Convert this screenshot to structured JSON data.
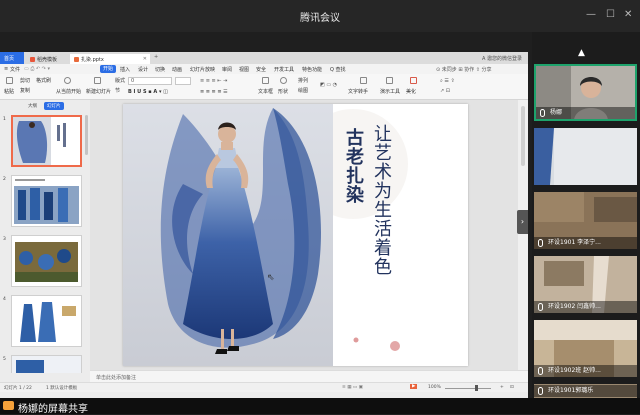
{
  "app": {
    "title": "腾讯会议"
  },
  "share_bar": {
    "label": "杨娜的屏幕共享"
  },
  "wps": {
    "tabs": [
      {
        "label": "首页"
      },
      {
        "label": "稻壳模板"
      },
      {
        "label": "扎染.pptx"
      }
    ],
    "tab_right": "A 邀您的微信登录",
    "menu": [
      "文件",
      "开始",
      "插入",
      "设计",
      "切换",
      "动画",
      "幻灯片放映",
      "审阅",
      "视图",
      "安全",
      "开发工具",
      "特色功能",
      "Q 查找"
    ],
    "menu_active_index": 1,
    "menu_right": "⊙ 未同步  ⊞ 协作  ⇧ 分享",
    "ribbon_labels": [
      "粘贴",
      "剪切",
      "复制",
      "格式刷",
      "从当前开始",
      "新建幻灯片",
      "版式",
      "节",
      "重置",
      "文本框",
      "形状",
      "排列",
      "绘图",
      "文字转手",
      "演示工具",
      "美化"
    ],
    "font_placeholder": "0",
    "panel_tabs": {
      "outline": "大纲",
      "slides": "幻灯片"
    },
    "thumb_numbers": [
      "1",
      "2",
      "3",
      "4",
      "5"
    ],
    "notes_placeholder": "单击此处添加备注",
    "status": {
      "slide_counter": "幻灯片 1 / 22",
      "theme": "1 默认设计模板",
      "zoom": "100%"
    }
  },
  "slide": {
    "title_main": "让艺术为生活着色",
    "title_side": "古老扎染"
  },
  "participants": [
    {
      "name": "杨娜",
      "active": true
    },
    {
      "name": ""
    },
    {
      "name": "环设1901 李泽宁..."
    },
    {
      "name": "环设1902 闫鑫帅..."
    },
    {
      "name": "环设1902班 赵帅..."
    },
    {
      "name": "环设1901郭璐乐"
    }
  ],
  "colors": {
    "accent_blue": "#2b6de5",
    "active_green": "#1ea36c",
    "title_navy": "#22335e",
    "dot_pink": "#d98a8a",
    "thumb_selected": "#ef6a4a"
  }
}
